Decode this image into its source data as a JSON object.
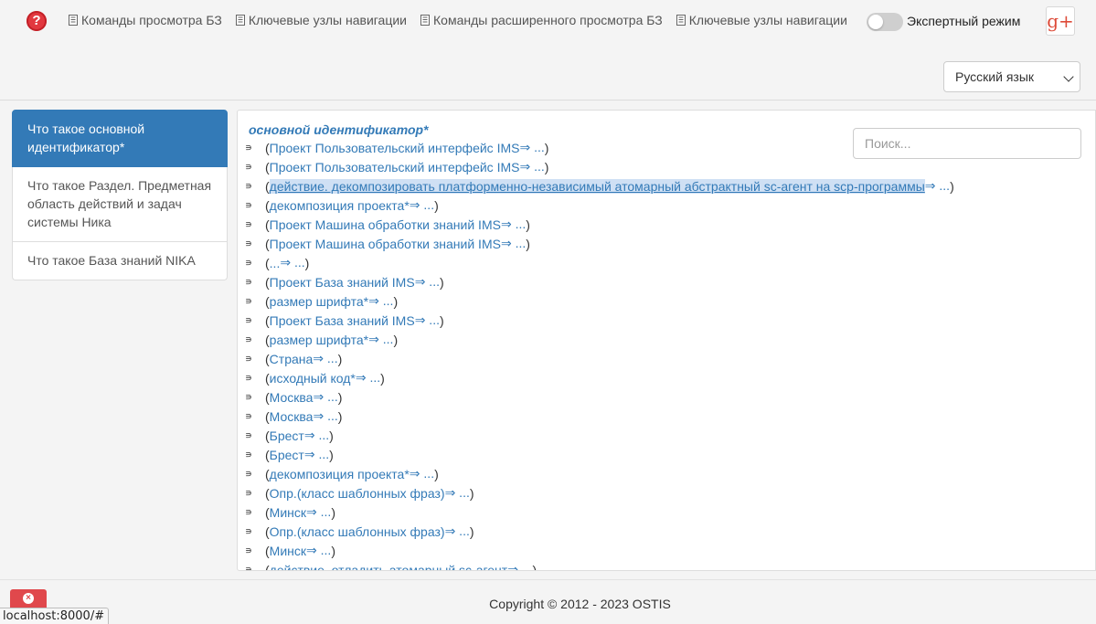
{
  "navbar": {
    "help_icon": "question-circle-icon",
    "links": [
      {
        "label": "Команды просмотра БЗ",
        "icon": "document-list-icon"
      },
      {
        "label": "Ключевые узлы навигации",
        "icon": "document-list-icon"
      },
      {
        "label": "Команды расширенного просмотра БЗ",
        "icon": "document-list-icon"
      },
      {
        "label": "Ключевые узлы навигации",
        "icon": "document-list-icon"
      }
    ],
    "expert_mode_label": "Экспертный режим",
    "expert_mode_on": false,
    "social_icon": "google-plus-icon",
    "social_label": "g+",
    "language_selected": "Русский язык"
  },
  "sidebar": {
    "items": [
      {
        "label": "Что такое основной идентификатор*",
        "active": true
      },
      {
        "label": "Что такое Раздел. Предметная область действий и задач системы Ника",
        "active": false
      },
      {
        "label": "Что такое База знаний NIKA",
        "active": false
      }
    ]
  },
  "main": {
    "title": "основной идентификатор*",
    "search_placeholder": "Поиск...",
    "relation_symbol": "∍",
    "rows": [
      {
        "text": "Проект Пользовательский интерфейс IMS",
        "suffix": " ⇒ ...",
        "highlight": false
      },
      {
        "text": "Проект Пользовательский интерфейс IMS",
        "suffix": " ⇒ ...",
        "highlight": false
      },
      {
        "text": "действие. декомпозировать платформенно-независимый атомарный абстрактный sc-агент на scp-программы",
        "suffix": " ⇒ ...",
        "highlight": true
      },
      {
        "text": "декомпозиция проекта*",
        "suffix": " ⇒ ...",
        "highlight": false
      },
      {
        "text": "Проект Машина обработки знаний IMS",
        "suffix": " ⇒ ...",
        "highlight": false
      },
      {
        "text": "Проект Машина обработки знаний IMS",
        "suffix": " ⇒ ...",
        "highlight": false
      },
      {
        "text": "...",
        "suffix": " ⇒ ...",
        "highlight": false
      },
      {
        "text": "Проект База знаний IMS",
        "suffix": " ⇒ ...",
        "highlight": false
      },
      {
        "text": "размер шрифта*",
        "suffix": " ⇒ ...",
        "highlight": false
      },
      {
        "text": "Проект База знаний IMS",
        "suffix": " ⇒ ...",
        "highlight": false
      },
      {
        "text": "размер шрифта*",
        "suffix": " ⇒ ...",
        "highlight": false
      },
      {
        "text": "Страна",
        "suffix": " ⇒ ...",
        "highlight": false
      },
      {
        "text": "исходный код*",
        "suffix": " ⇒ ...",
        "highlight": false
      },
      {
        "text": "Москва",
        "suffix": " ⇒ ...",
        "highlight": false
      },
      {
        "text": "Москва",
        "suffix": " ⇒ ...",
        "highlight": false
      },
      {
        "text": "Брест",
        "suffix": " ⇒ ...",
        "highlight": false
      },
      {
        "text": "Брест",
        "suffix": " ⇒ ...",
        "highlight": false
      },
      {
        "text": "декомпозиция проекта*",
        "suffix": " ⇒ ...",
        "highlight": false
      },
      {
        "text": "Опр.(класс шаблонных фраз)",
        "suffix": " ⇒ ...",
        "highlight": false
      },
      {
        "text": "Минск",
        "suffix": " ⇒ ...",
        "highlight": false
      },
      {
        "text": "Опр.(класс шаблонных фраз)",
        "suffix": " ⇒ ...",
        "highlight": false
      },
      {
        "text": "Минск",
        "suffix": " ⇒ ...",
        "highlight": false
      },
      {
        "text": "действие. отладить атомарный sc-агент",
        "suffix": " ⇒ ...",
        "highlight": false
      }
    ]
  },
  "footer": {
    "copyright": "Copyright © 2012 - 2023 OSTIS",
    "close_icon": "close-circle-icon"
  },
  "status_bar": {
    "url": "localhost:8000/#"
  },
  "colors": {
    "accent": "#337ab7",
    "danger": "#e0484c",
    "help_red": "#e2383f",
    "google_red": "#dd4b39"
  }
}
